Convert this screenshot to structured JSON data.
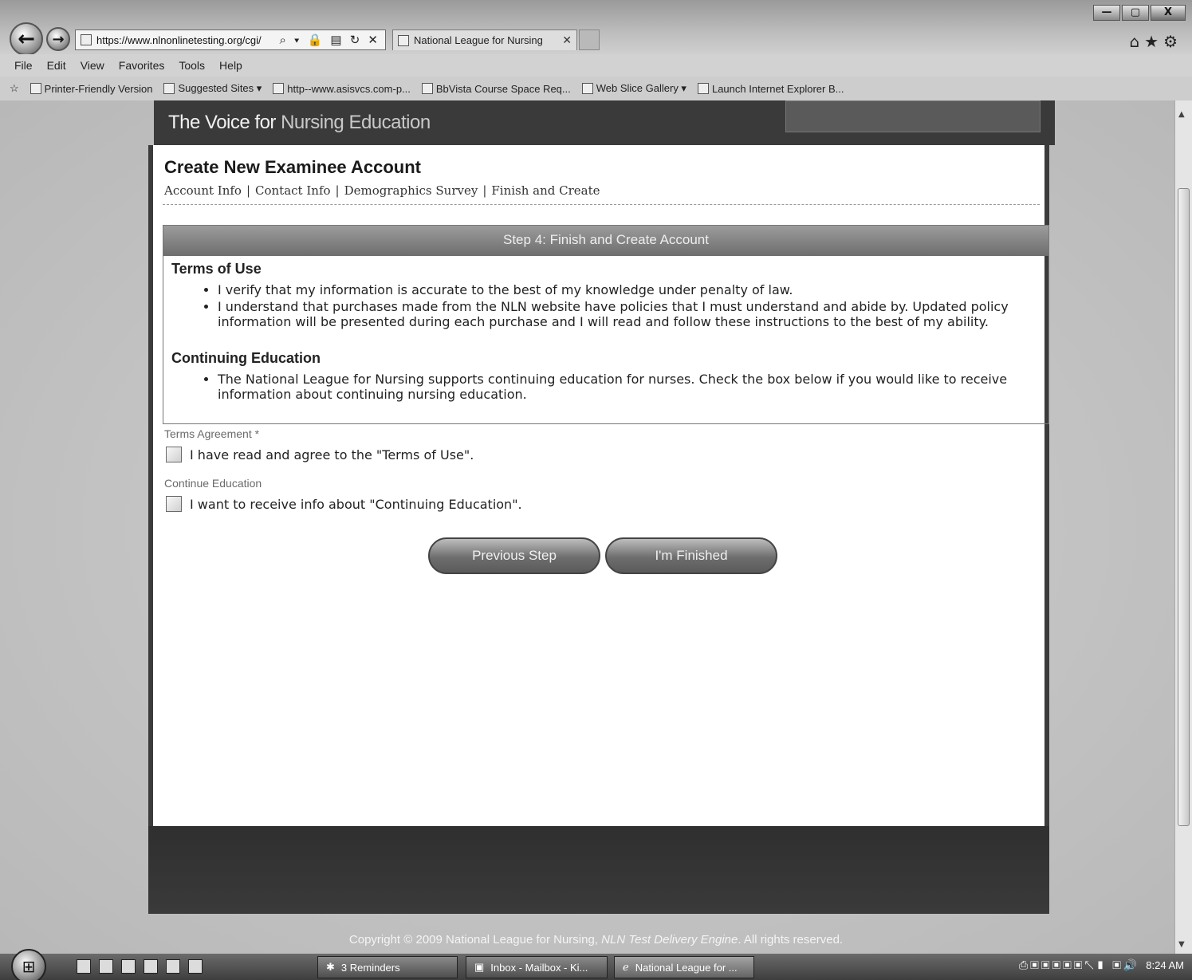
{
  "browser": {
    "address_url": "https://www.nlnonlinetesting.org/cgi/",
    "address_tools": "⌕ ▾ 🔒 ▤ ↻ ✕",
    "tab_title": "National League for Nursing",
    "tab_close": "✕",
    "win_min": "—",
    "win_max": "▢",
    "win_close": "X",
    "right_icons": "⌂★⚙",
    "menu": [
      "File",
      "Edit",
      "View",
      "Favorites",
      "Tools",
      "Help"
    ],
    "favorites": [
      {
        "label": "Printer-Friendly Version",
        "icon": "page-icon"
      },
      {
        "label": "Suggested Sites ▾",
        "icon": "ie-icon"
      },
      {
        "label": "http--www.asisvcs.com-p...",
        "icon": "link-icon"
      },
      {
        "label": "BbVista Course Space Req...",
        "icon": "page-icon"
      },
      {
        "label": "Web Slice Gallery ▾",
        "icon": "page-icon"
      },
      {
        "label": "Launch Internet Explorer B...",
        "icon": "ie-icon"
      }
    ]
  },
  "site": {
    "tagline_main": "The Voice for ",
    "tagline_accent": "Nursing Education"
  },
  "page": {
    "title": "Create New Examinee Account",
    "steps": [
      "Account Info",
      "Contact Info",
      "Demographics Survey",
      "Finish and Create"
    ],
    "step_separator": "|",
    "step_header": "Step 4: Finish and Create Account",
    "terms_title": "Terms of Use",
    "terms_items": [
      "I verify that my information is accurate to the best of my knowledge under penalty of law.",
      "I understand that purchases made from the NLN website have policies that I must understand and abide by. Updated policy information will be presented during each purchase and I will read and follow these instructions to the best of my ability."
    ],
    "ce_title": "Continuing Education",
    "ce_items": [
      "The National League for Nursing supports continuing education for nurses. Check the box below if you would like to receive information about continuing nursing education."
    ],
    "terms_agreement_label": "Terms Agreement *",
    "terms_agreement_text": "I have read and agree to the \"Terms of Use\".",
    "continue_education_label": "Continue Education",
    "continue_education_text": "I want to receive info about \"Continuing Education\".",
    "previous_button": "Previous Step",
    "finish_button": "I'm Finished"
  },
  "footer": {
    "copyright_main": "Copyright © 2009 National League for Nursing, ",
    "copyright_em": "NLN Test Delivery Engine",
    "copyright_end": ". All rights reserved."
  },
  "taskbar": {
    "start": "⊞",
    "tasks": [
      "3 Reminders",
      "Inbox - Mailbox - Ki...",
      "National League for ..."
    ],
    "tray_icons": "⎙▣▣▣▣▣↖▮ ▣🔊",
    "clock": "8:24 AM"
  }
}
